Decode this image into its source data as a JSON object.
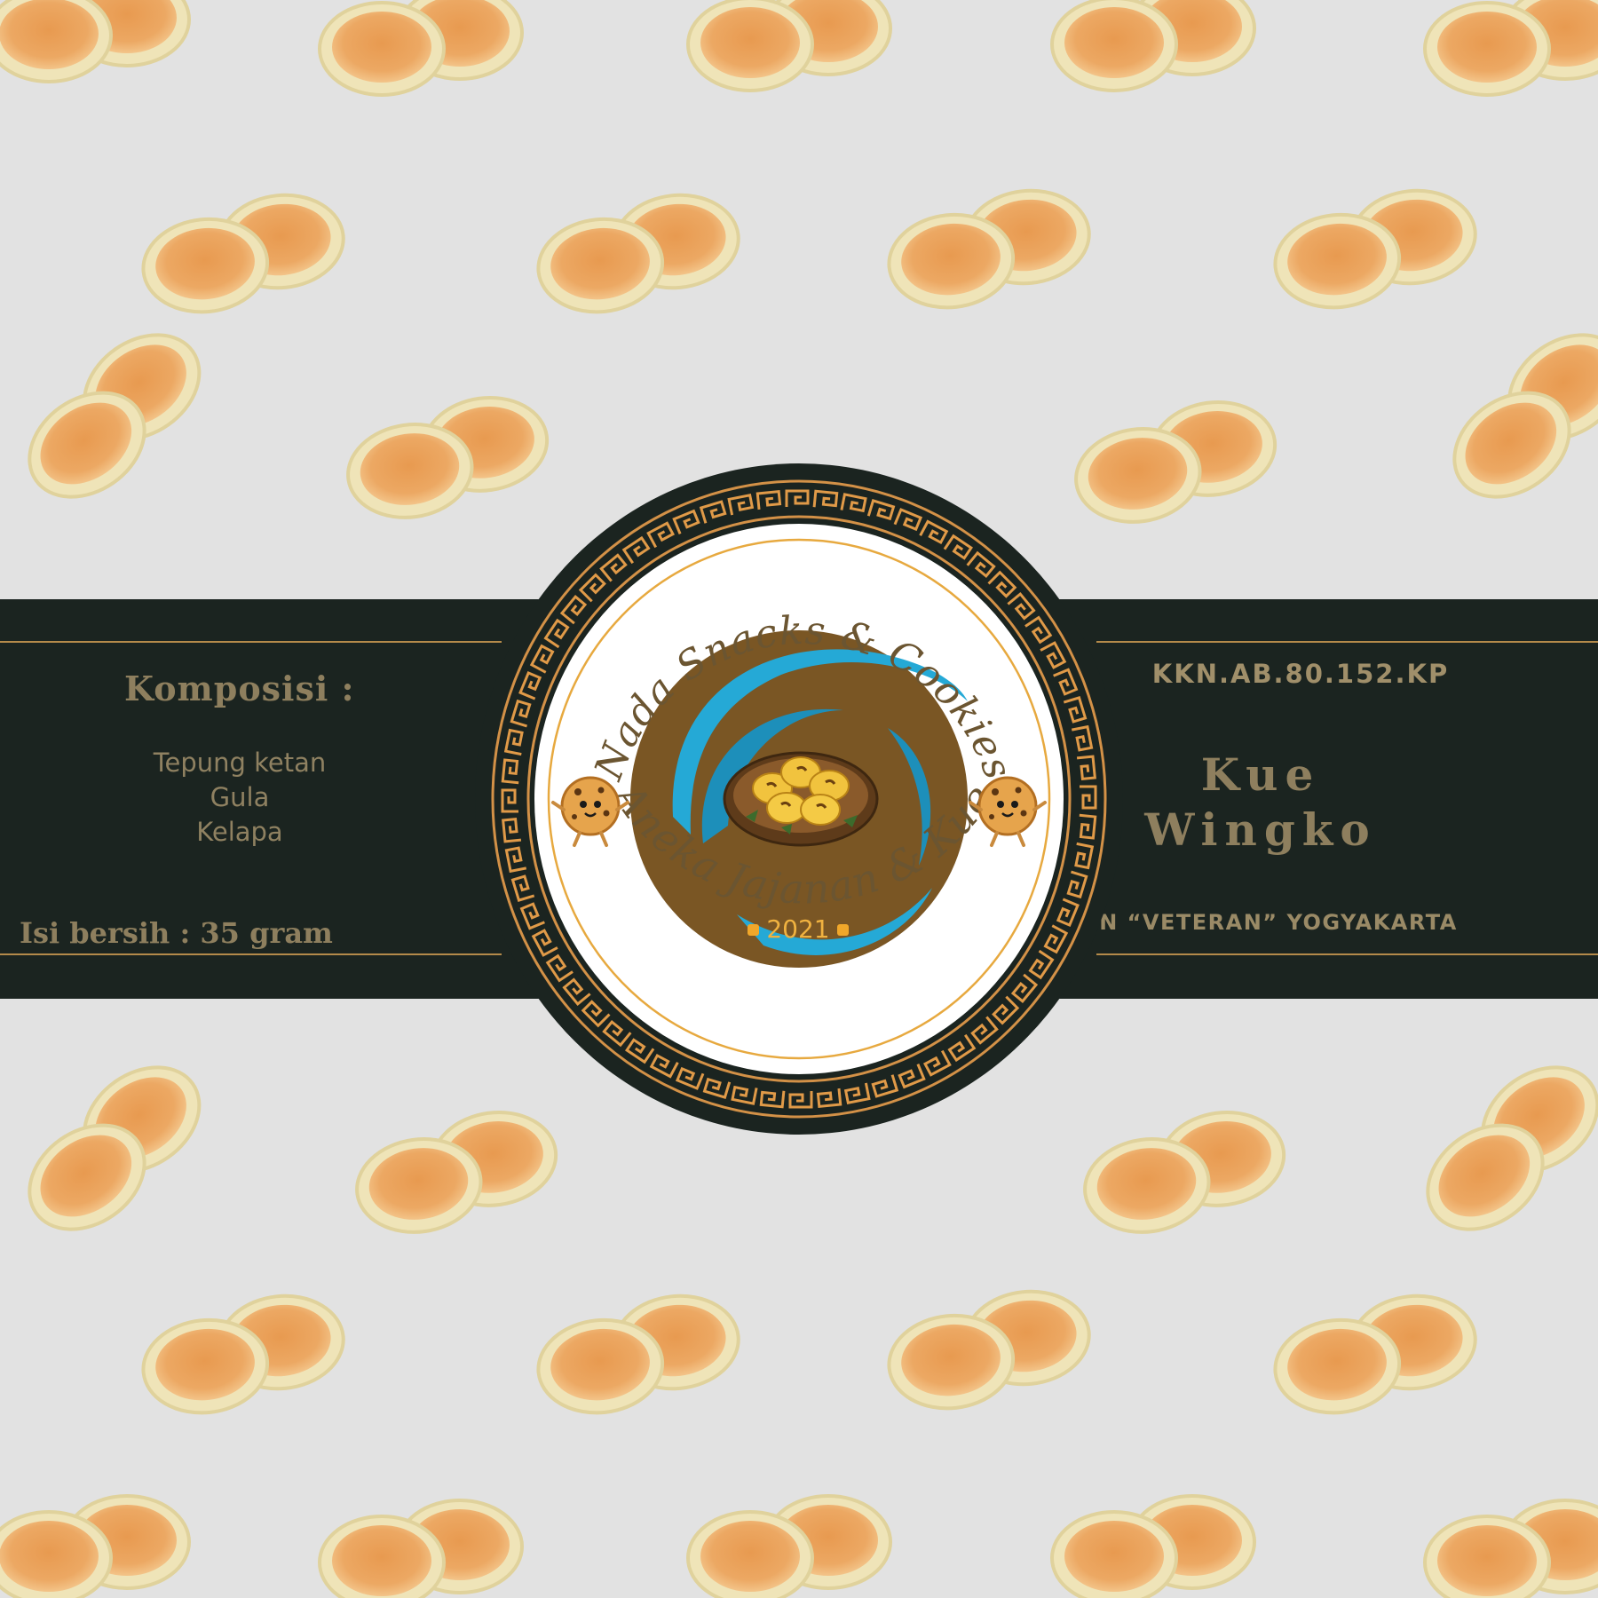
{
  "label": {
    "composition_title": "Komposisi :",
    "ingredients": [
      "Tepung ketan",
      "Gula",
      "Kelapa"
    ],
    "net_weight": "Isi bersih : 35 gram",
    "registration_code": "KKN.AB.80.152.KP",
    "product_name_line1": "Kue",
    "product_name_line2": "Wingko",
    "institution": "UPN “VETERAN” YOGYAKARTA"
  },
  "logo": {
    "brand_top": "Nada Snacks & Cookies",
    "brand_bottom": "Aneka Jajanan & Kue",
    "year": "2021"
  },
  "colors": {
    "background": "#e2e2e2",
    "band": "#1b2420",
    "gold": "#b48a4a",
    "text": "#8e7f5e",
    "logo_center": "#7a5624",
    "swirl": "#25a9d6",
    "pattern_orange": "#e9a15a"
  },
  "icons": [
    "wingko-cake-pattern",
    "greek-key-border",
    "cookie-mascot-icon",
    "wingko-plate-icon"
  ]
}
